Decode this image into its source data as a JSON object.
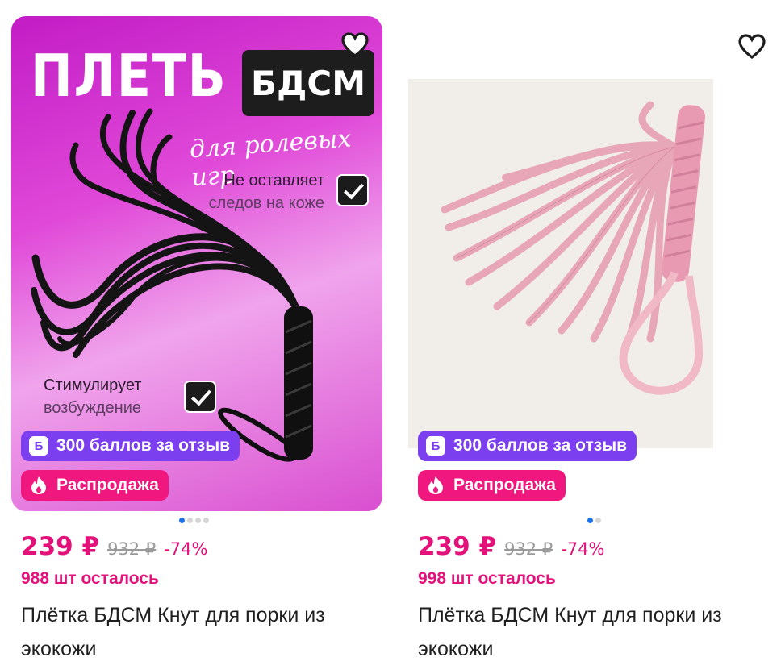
{
  "products": [
    {
      "banner": {
        "title": "ПЛЕТЬ",
        "tag": "БДСМ",
        "script": "для ролевых игр",
        "feature1_line1": "Не оставляет",
        "feature1_line2": "следов на коже",
        "feature2_line1": "Стимулирует",
        "feature2_line2": "возбуждение"
      },
      "points_badge": "300 баллов за отзыв",
      "points_icon": "Б",
      "sale_badge": "Распродажа",
      "gallery": {
        "count": 4,
        "active": 1
      },
      "price": "239 ₽",
      "old_price": "932 ₽",
      "discount": "-74%",
      "stock": "988 шт осталось",
      "title": "Плётка БДСМ Кнут для порки из экокожи"
    },
    {
      "points_badge": "300 баллов за отзыв",
      "points_icon": "Б",
      "sale_badge": "Распродажа",
      "gallery": {
        "count": 2,
        "active": 1
      },
      "price": "239 ₽",
      "old_price": "932 ₽",
      "discount": "-74%",
      "stock": "998 шт осталось",
      "title": "Плётка БДСМ Кнут для порки из экокожи"
    }
  ],
  "colors": {
    "accent_price": "#e3127a",
    "points_badge": "#7b3ff0",
    "sale_badge": "#f0177f",
    "gallery_dot_active": "#1a73e8"
  },
  "icons": [
    "heart-icon",
    "points-icon",
    "flame-icon",
    "check-icon"
  ]
}
